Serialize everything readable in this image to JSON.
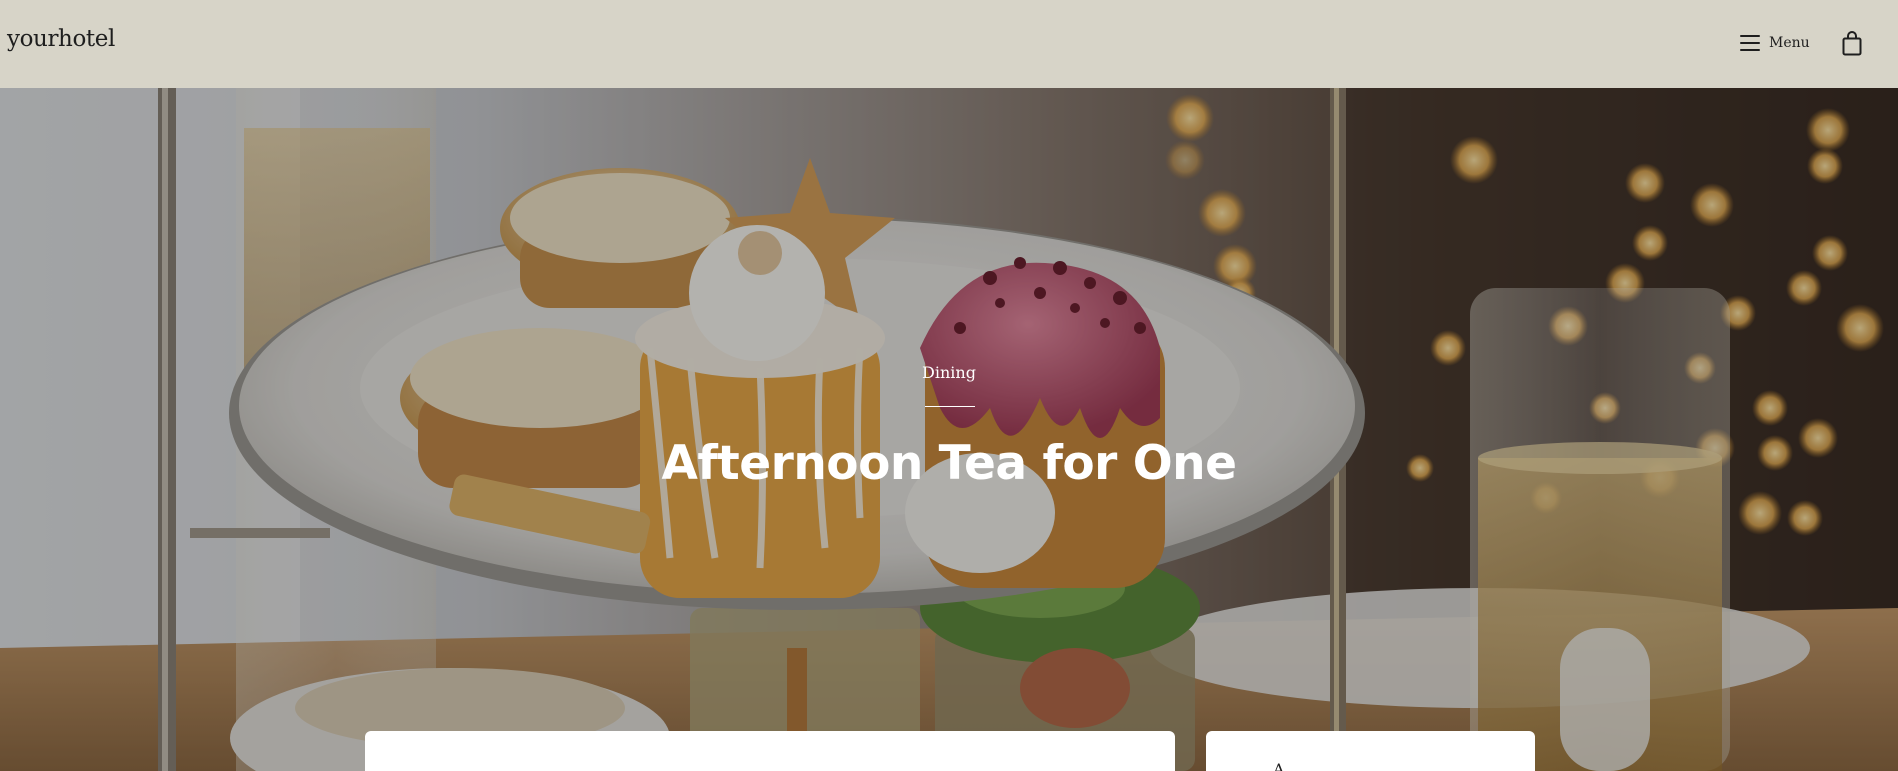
{
  "header": {
    "logo": "yourhotel",
    "menu_label": "Menu",
    "menu_icon": "hamburger-icon",
    "cart_icon": "shopping-bag-icon"
  },
  "hero": {
    "eyebrow": "Dining",
    "title": "Afternoon Tea for One",
    "image": "afternoon-tea-cake-stand-photo"
  },
  "booking_card": {
    "partial_text": "A"
  },
  "colors": {
    "header_bg": "#d7d4c8",
    "text_dark": "#1e1e1e",
    "hero_text": "#ffffff"
  }
}
